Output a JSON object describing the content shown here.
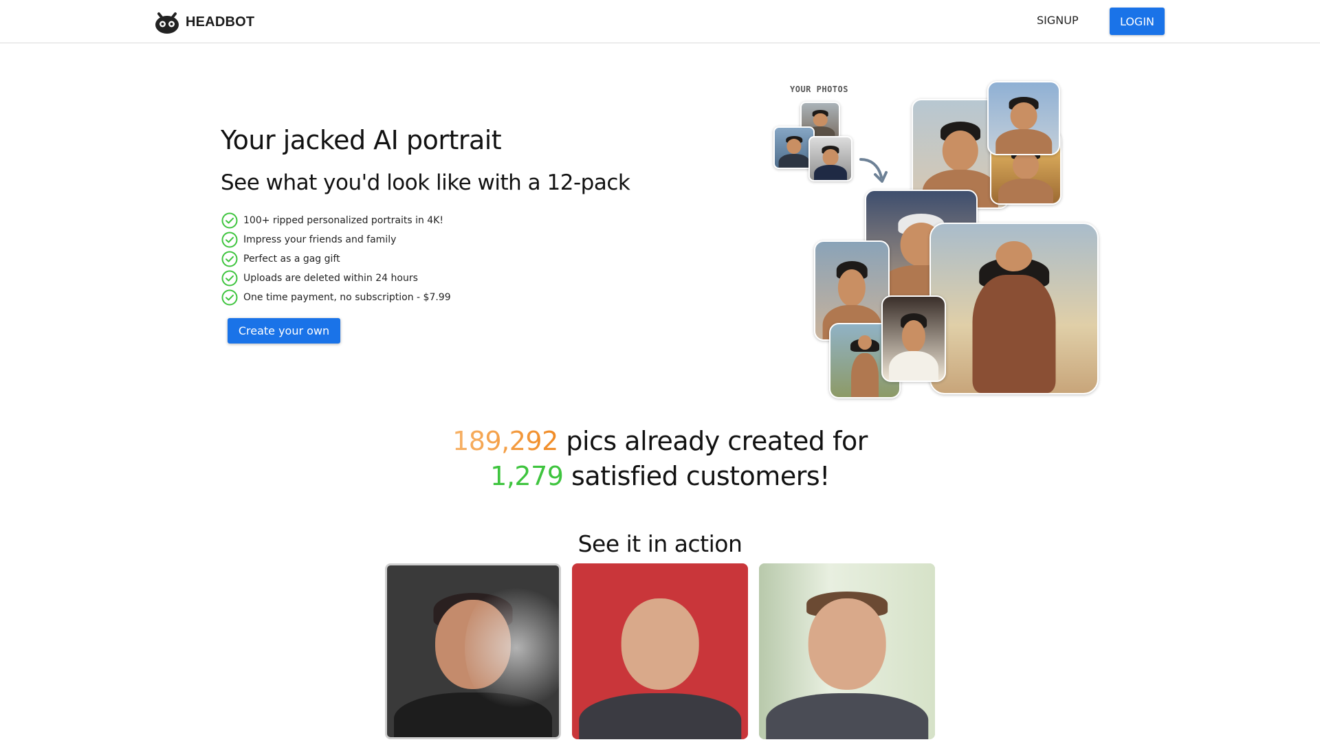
{
  "header": {
    "brand": "HEADBOT",
    "signup_label": "SIGNUP",
    "login_label": "LOGIN"
  },
  "hero": {
    "title": "Your jacked AI portrait",
    "subtitle": "See what you'd look like with a 12-pack",
    "features": [
      "100+ ripped personalized portraits in 4K!",
      "Impress your friends and family",
      "Perfect as a gag gift",
      "Uploads are deleted within 24 hours",
      "One time payment, no subscription - $7.99"
    ],
    "cta_label": "Create your own"
  },
  "collage": {
    "your_photos_label": "YOUR PHOTOS"
  },
  "stats": {
    "pics_count": "189,292",
    "pics_text": "pics already created for",
    "customers_count": "1,279",
    "customers_text": "satisfied customers!"
  },
  "action": {
    "title": "See it in action"
  },
  "colors": {
    "accent": "#1a73e8",
    "check": "#3ec43e",
    "orange": "#f08a24",
    "green": "#3ec43e"
  },
  "icons": {
    "logo": "robot-head-icon",
    "feature": "check-circle-icon",
    "arrow": "curved-arrow-icon"
  }
}
